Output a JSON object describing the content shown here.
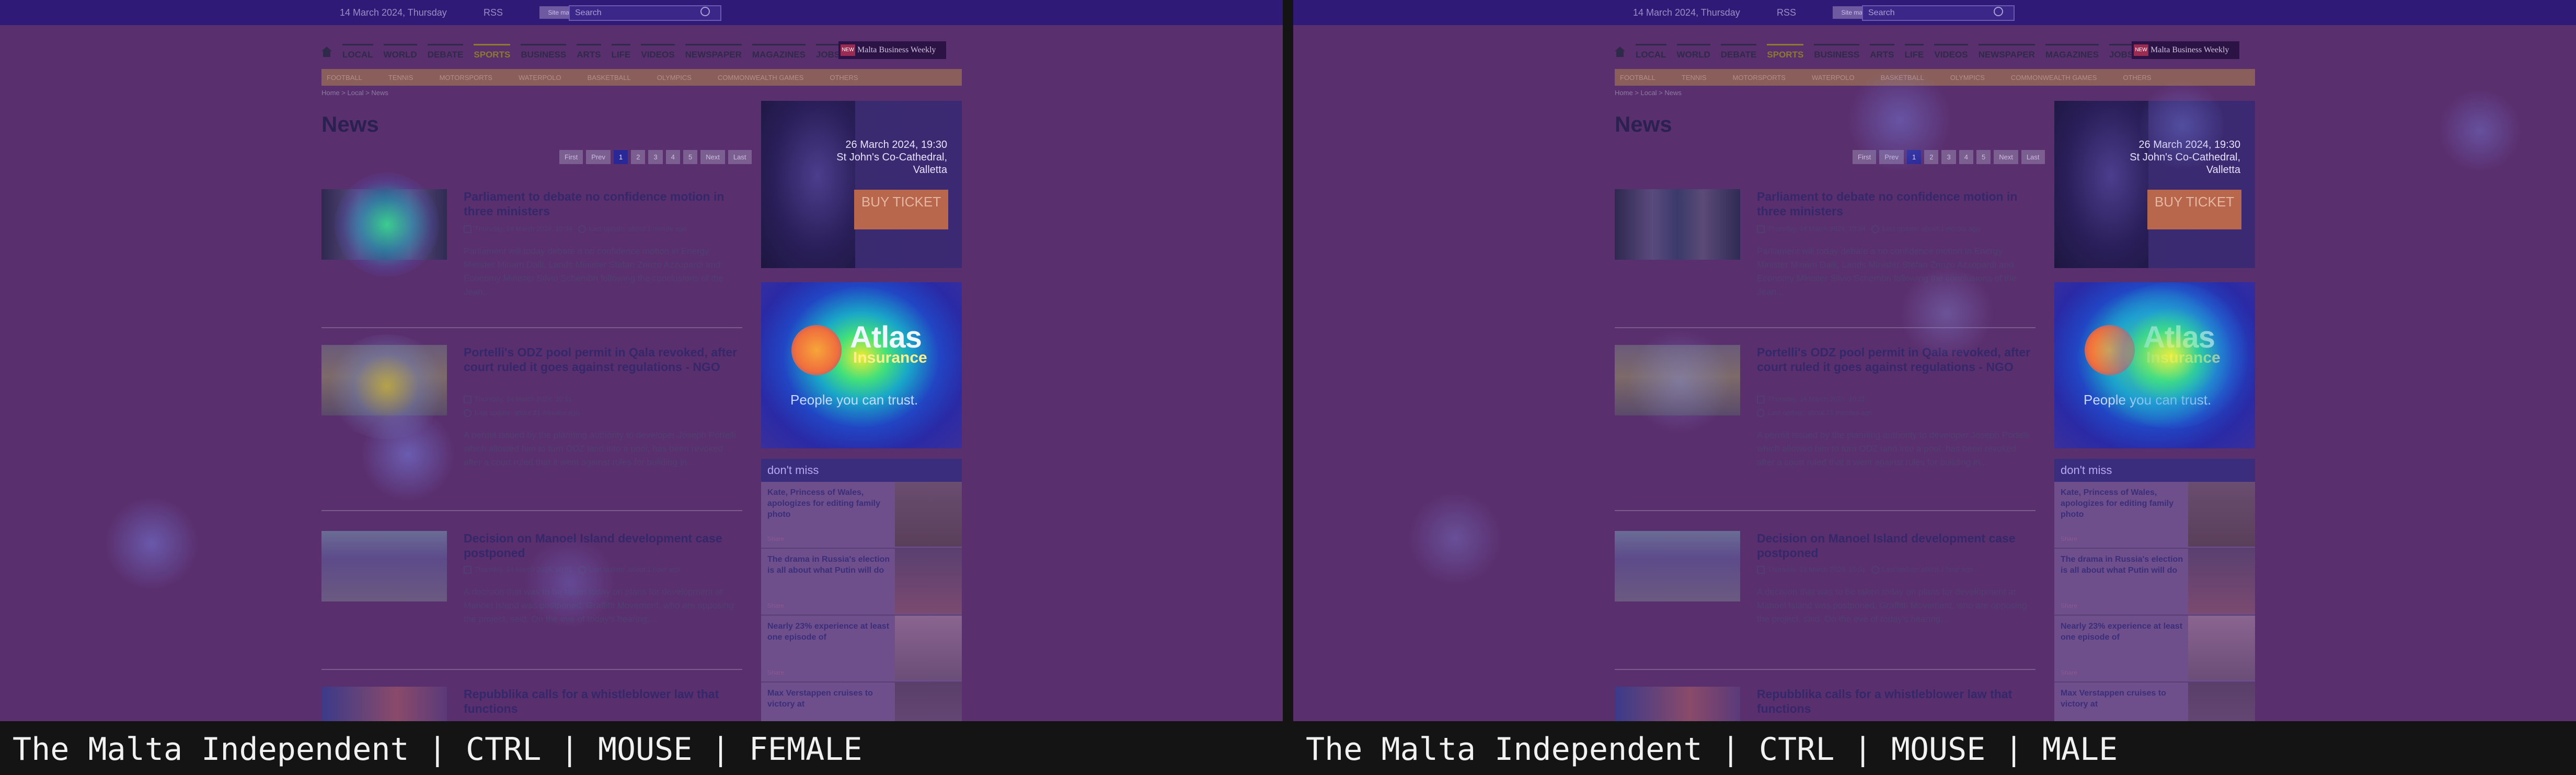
{
  "site": {
    "date": "14 March 2024, Thursday",
    "rss": "RSS",
    "sitemap": "Site map",
    "search_placeholder": "Search",
    "nav": [
      "LOCAL",
      "WORLD",
      "DEBATE",
      "SPORTS",
      "BUSINESS",
      "ARTS",
      "LIFE",
      "VIDEOS",
      "NEWSPAPER",
      "MAGAZINES",
      "JOBS IN MALTA"
    ],
    "mbw_badge": "NEW",
    "mbw_label": "Malta Business Weekly",
    "subnav": [
      "FOOTBALL",
      "TENNIS",
      "MOTORSPORTS",
      "WATERPOLO",
      "BASKETBALL",
      "OLYMPICS",
      "COMMONWEALTH GAMES",
      "OTHERS"
    ],
    "breadcrumb": "Home > Local > News",
    "page_title": "News",
    "pager": [
      "First",
      "Prev",
      "1",
      "2",
      "3",
      "4",
      "5",
      "Next",
      "Last"
    ],
    "articles": [
      {
        "headline": "Parliament to debate no confidence motion in three ministers",
        "date": "Thursday, 14 March 2024, 10:34",
        "updated": "Last update: about 1 minute ago",
        "body": "Parliament will today debate a no confidence motion in Energy Minister Miriam Dalli, Lands Minister Stefan Zrinzo Azzopardi and Economy Minister Silvio Schembri following the conclusions of the Jean..."
      },
      {
        "headline": "Portelli's ODZ pool permit in Qala revoked, after court ruled it goes against regulations - NGO",
        "date": "Thursday, 14 March 2024, 10:11",
        "updated": "Last update: about 21 minutes ago",
        "body": "A permit issued by the planning authority to developer Joseph Portelli which allowed him to turn ODZ land into a pool, has been revoked after a court ruled that it went against rules for building in..."
      },
      {
        "headline": "Decision on Manoel Island development case postponed",
        "date": "Thursday, 14 March 2024, 10:01",
        "updated": "Last update: about 1 hour ago",
        "body": "A decision that was to be taken today on plans for development at Manoel Island was postponed, Graffitti Movement, who are opposing the project, said. On the eve of today's hearing,..."
      },
      {
        "headline": "Repubblika calls for a whistleblower law that functions",
        "date": "",
        "updated": "",
        "body": ""
      }
    ],
    "ad1": {
      "date_line": "26 March 2024, 19:30",
      "venue_line1": "St John's Co-Cathedral,",
      "venue_line2": "Valletta",
      "button": "BUY TICKET"
    },
    "ad2": {
      "logo": "Atlas",
      "logo_sub": "Insurance",
      "tagline": "People you can trust."
    },
    "dont_miss": {
      "heading": "don't miss",
      "share": "Share",
      "items": [
        "Kate, Princess of Wales, apologizes for editing family photo",
        "The drama in Russia's election is all about what Putin will do",
        "Nearly 23% experience at least one episode of",
        "Max Verstappen cruises to victory at"
      ]
    }
  },
  "captions": {
    "left": "The Malta Independent | CTRL | MOUSE | FEMALE",
    "right": "The Malta Independent | CTRL | MOUSE | MALE"
  },
  "colors": {
    "overlay": "#5a2f6e",
    "topbar": "#2f1a78",
    "accent_sports": "#8d7a2c",
    "caption_bg": "#141414"
  }
}
